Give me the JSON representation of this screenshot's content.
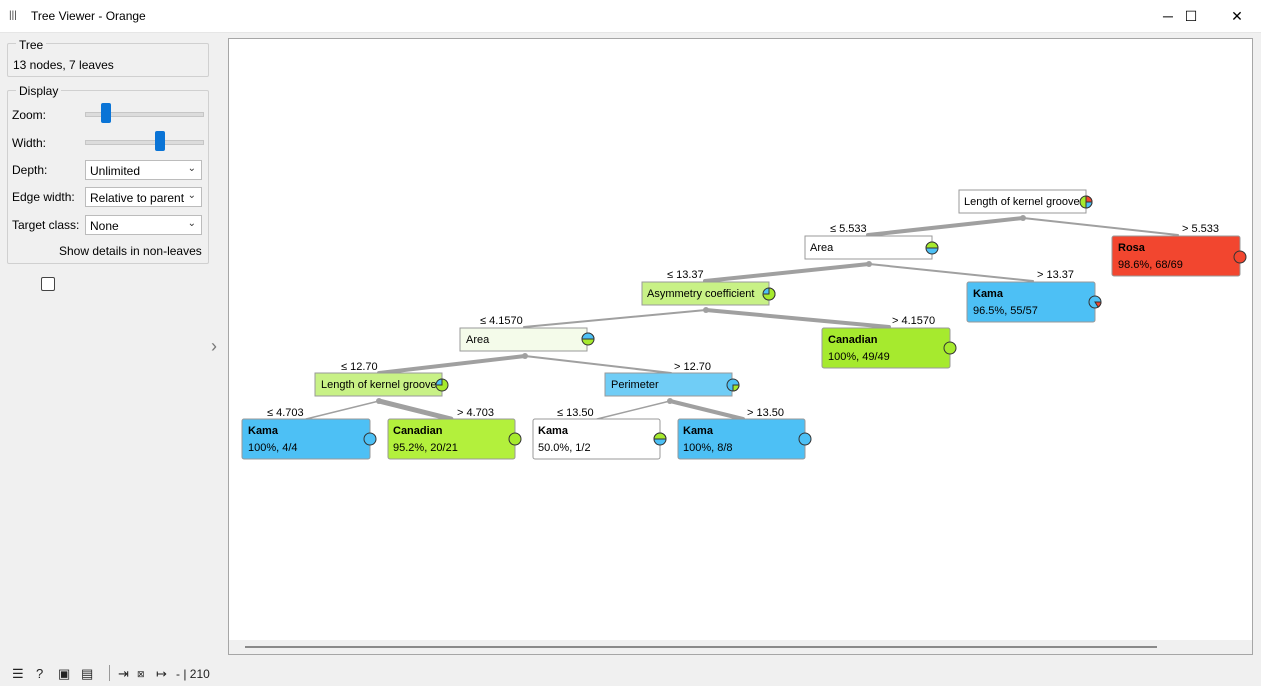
{
  "window": {
    "title": "Tree Viewer - Orange",
    "minimize": "─",
    "maximize": "☐",
    "close": "✕",
    "app_icon": "orange-logo-icon"
  },
  "sidebar": {
    "tree_group": {
      "title": "Tree",
      "summary": "13 nodes, 7 leaves"
    },
    "display_group": {
      "title": "Display",
      "zoom_label": "Zoom:",
      "zoom_level": 0.15,
      "width_label": "Width:",
      "width_level": 0.65,
      "depth_label": "Depth:",
      "depth_value": "Unlimited",
      "edge_width_label": "Edge width:",
      "edge_width_value": "Relative to parent",
      "target_class_label": "Target class:",
      "target_class_value": "None",
      "show_details_label": "Show details in non-leaves",
      "show_details_checked": false
    }
  },
  "status": {
    "instances_text": "- | 210"
  },
  "colors": {
    "kama": "#4dc0f5",
    "canadian": "#a6ea2e",
    "rosa": "#f2462f",
    "edge": "#a0a0a0"
  },
  "tree": {
    "nodes": [
      {
        "id": "n1",
        "label": "Length of kernel groove",
        "kind": "split"
      },
      {
        "id": "n2",
        "label": "Area",
        "kind": "split"
      },
      {
        "id": "n3",
        "class": "Rosa",
        "stat": "98.6%, 68/69",
        "kind": "leaf"
      },
      {
        "id": "n4",
        "label": "Asymmetry coefficient",
        "kind": "split"
      },
      {
        "id": "n5",
        "class": "Kama",
        "stat": "96.5%, 55/57",
        "kind": "leaf"
      },
      {
        "id": "n6",
        "label": "Area",
        "kind": "split"
      },
      {
        "id": "n7",
        "class": "Canadian",
        "stat": "100%, 49/49",
        "kind": "leaf"
      },
      {
        "id": "n8",
        "label": "Length of kernel groove",
        "kind": "split"
      },
      {
        "id": "n9",
        "label": "Perimeter",
        "kind": "split"
      },
      {
        "id": "n10",
        "class": "Kama",
        "stat": "100%, 4/4",
        "kind": "leaf"
      },
      {
        "id": "n11",
        "class": "Canadian",
        "stat": "95.2%, 20/21",
        "kind": "leaf"
      },
      {
        "id": "n12",
        "class": "Kama",
        "stat": "50.0%, 1/2",
        "kind": "leaf"
      },
      {
        "id": "n13",
        "class": "Kama",
        "stat": "100%, 8/8",
        "kind": "leaf"
      }
    ],
    "edge_labels": [
      "≤ 5.533",
      "> 5.533",
      "≤ 13.37",
      "> 13.37",
      "≤ 4.1570",
      "> 4.1570",
      "≤ 12.70",
      "> 12.70",
      "≤ 4.703",
      "> 4.703",
      "≤ 13.50",
      "> 13.50"
    ]
  }
}
